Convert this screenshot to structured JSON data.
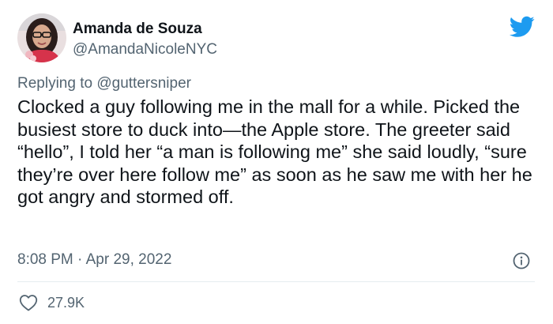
{
  "author": {
    "name": "Amanda de Souza",
    "handle": "@AmandaNicoleNYC"
  },
  "reply": {
    "prefix": "Replying to ",
    "handle": "@guttersniper"
  },
  "tweet": {
    "text": "Clocked a guy following me in the mall for a while. Picked the busiest store to duck into—the Apple store. The greeter said “hello”, I told her “a man is following me” she said loudly, “sure they’re over here follow me” as soon as he saw me with her he got angry and stormed off.",
    "timestamp": "8:08 PM · Apr 29, 2022"
  },
  "actions": {
    "like_count": "27.9K"
  },
  "icons": {
    "brand": "twitter-bird-icon",
    "info": "info-icon",
    "like": "heart-icon"
  },
  "colors": {
    "brand": "#1d9bf0",
    "secondary_text": "#536471",
    "primary_text": "#0f1419",
    "divider": "#e6ecf0"
  }
}
